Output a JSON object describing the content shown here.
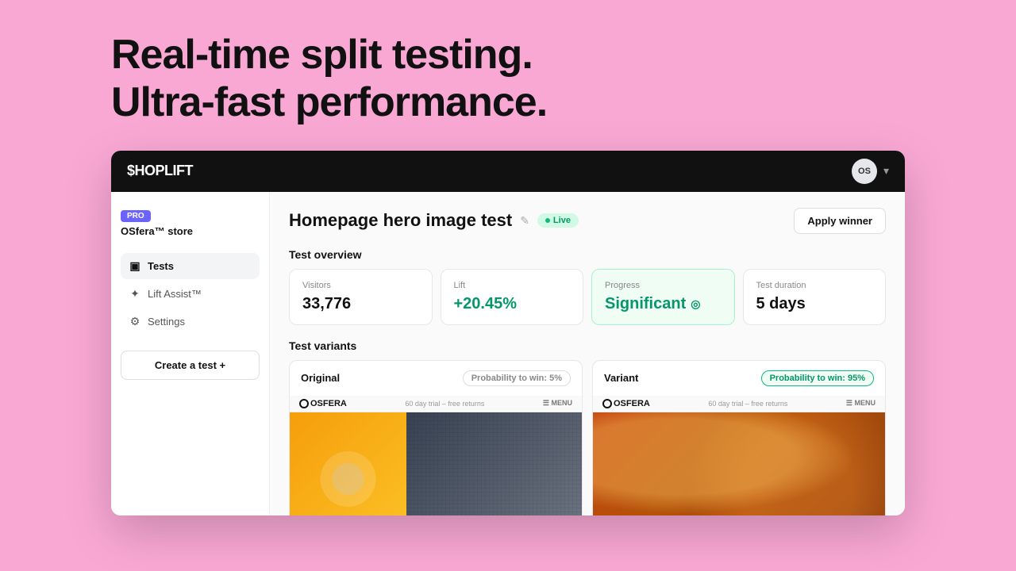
{
  "hero": {
    "line1": "Real-time split testing.",
    "line2": "Ultra-fast performance."
  },
  "nav": {
    "logo": "$HOPLIFT",
    "avatar_initials": "OS",
    "chevron": "▾"
  },
  "sidebar": {
    "pro_label": "PRO",
    "store_name": "OSfera™ store",
    "items": [
      {
        "id": "tests",
        "label": "Tests",
        "icon": "▣",
        "active": true
      },
      {
        "id": "lift-assist",
        "label": "Lift Assist™",
        "icon": "✦",
        "active": false
      },
      {
        "id": "settings",
        "label": "Settings",
        "icon": "⚙",
        "active": false
      }
    ],
    "create_test_label": "Create a test +"
  },
  "page": {
    "title": "Homepage hero image test",
    "live_label": "Live",
    "apply_winner_label": "Apply winner",
    "test_overview_label": "Test overview",
    "cards": [
      {
        "id": "visitors",
        "label": "Visitors",
        "value": "33,776",
        "type": "normal"
      },
      {
        "id": "lift",
        "label": "Lift",
        "value": "+20.45%",
        "type": "positive"
      },
      {
        "id": "progress",
        "label": "Progress",
        "value": "Significant",
        "type": "significant"
      },
      {
        "id": "duration",
        "label": "Test duration",
        "value": "5 days",
        "type": "normal"
      }
    ],
    "test_variants_label": "Test variants",
    "variants": [
      {
        "id": "original",
        "name": "Original",
        "probability_label": "Probability to win: 5%",
        "probability_type": "low",
        "preview_bar_text": "60 day trial – free returns",
        "logo": "OSFERA"
      },
      {
        "id": "variant",
        "name": "Variant",
        "probability_label": "Probability to win: 95%",
        "probability_type": "high",
        "preview_bar_text": "60 day trial – free returns",
        "logo": "OSFERA"
      }
    ]
  }
}
